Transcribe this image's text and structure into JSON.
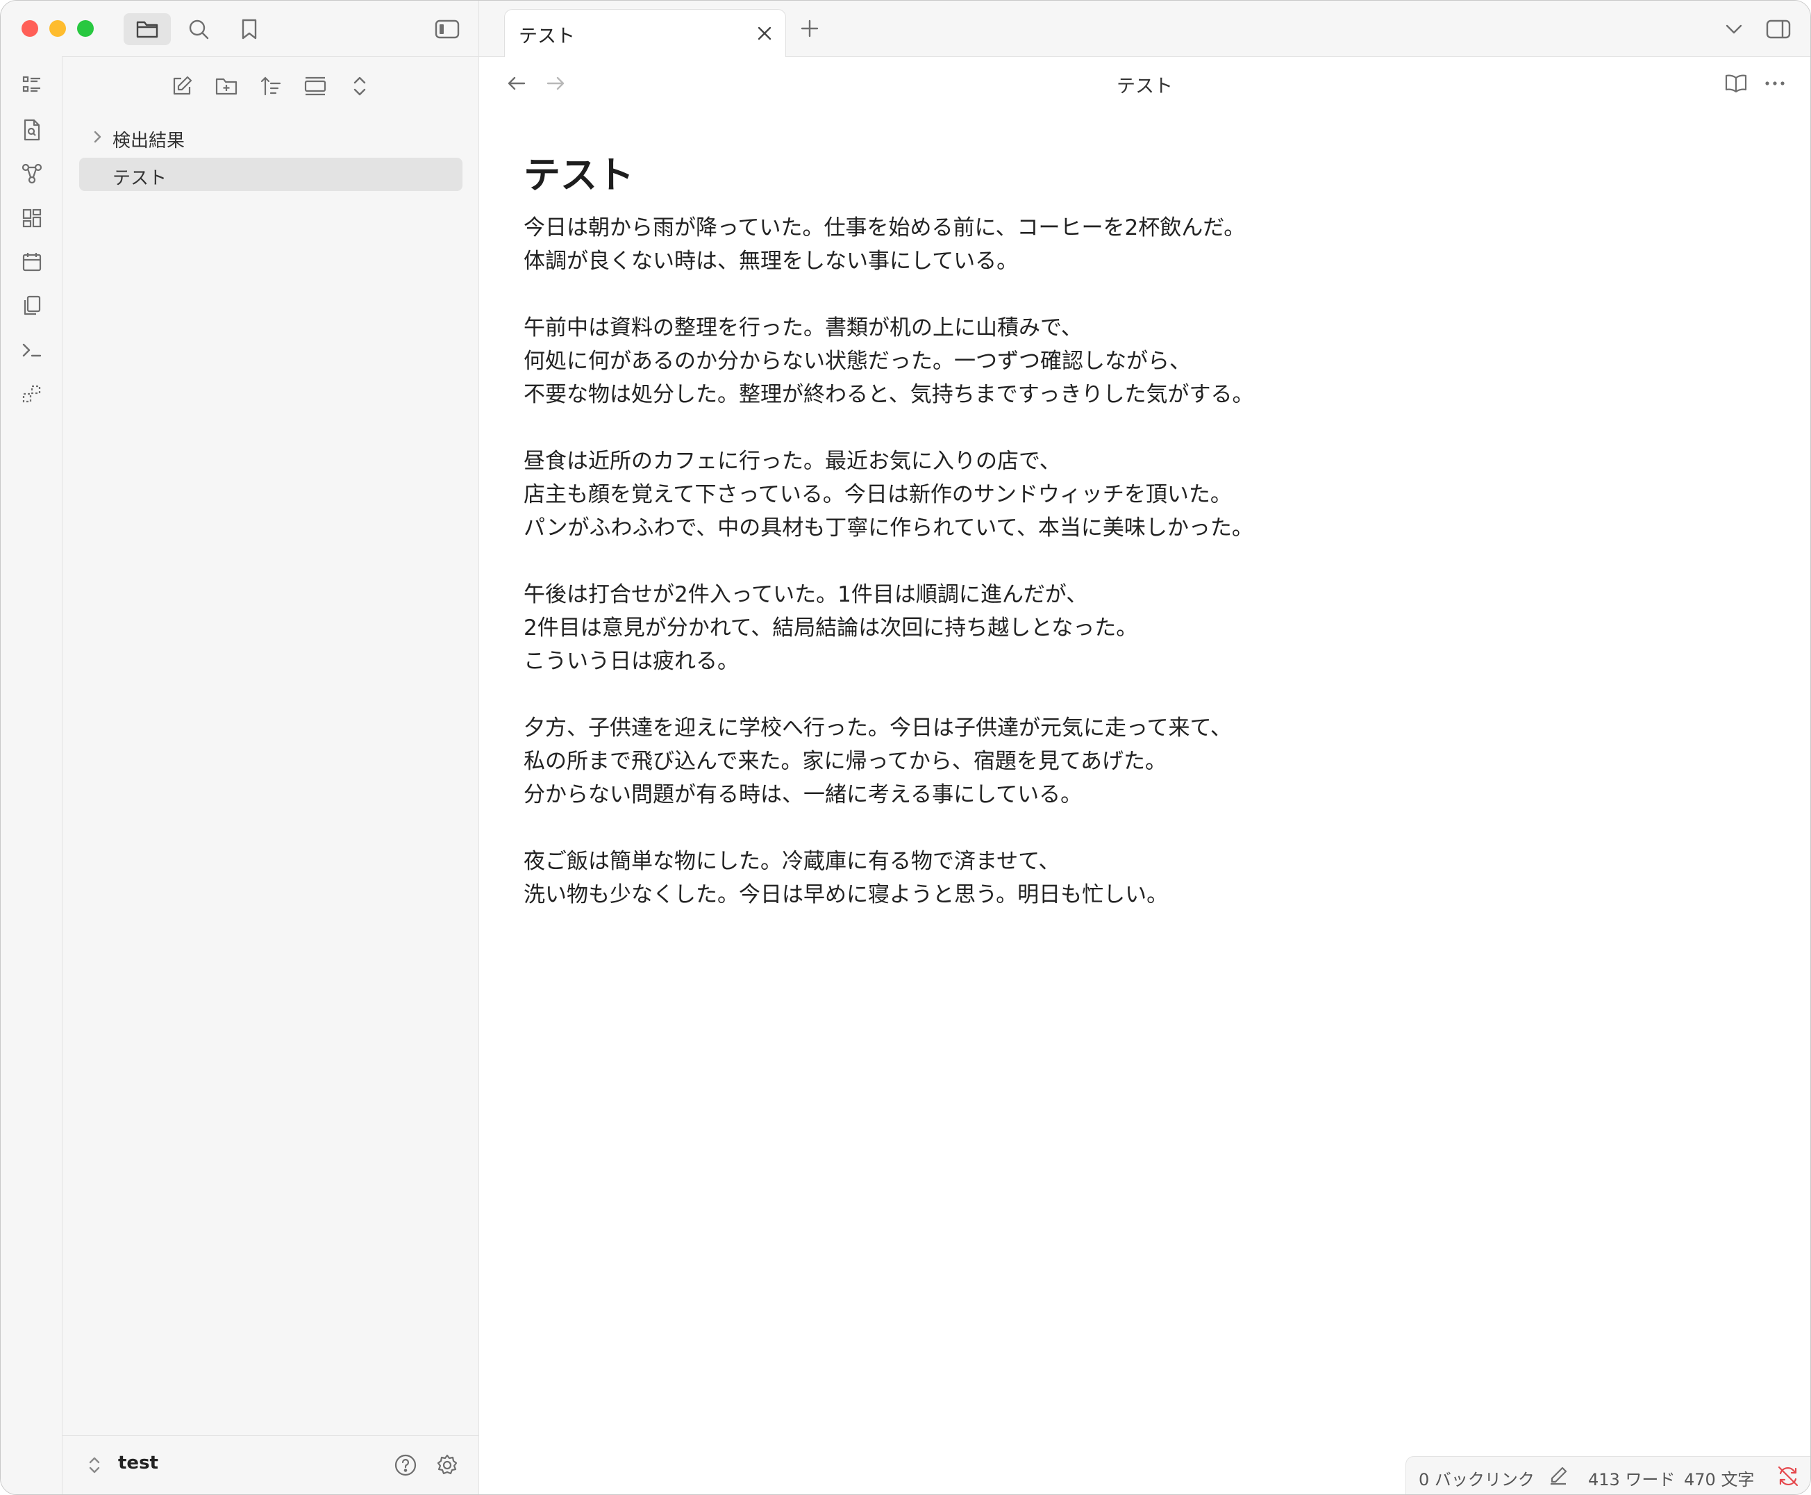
{
  "window": {
    "traffic_lights": {
      "close": "#ff5f57",
      "minimize": "#febc2e",
      "zoom": "#28c840"
    }
  },
  "titlebar": {
    "icons": [
      "folder-icon",
      "search-icon",
      "bookmark-icon",
      "sidebar-toggle-icon"
    ]
  },
  "tabs": [
    {
      "title": "テスト"
    }
  ],
  "ribbon": {
    "icons": [
      "outline-icon",
      "file-search-icon",
      "graph-icon",
      "canvas-icon",
      "calendar-icon",
      "copy-icon",
      "terminal-icon",
      "template-icon"
    ]
  },
  "sidebar": {
    "tree": [
      {
        "label": "検出結果",
        "type": "folder",
        "collapsed": true
      },
      {
        "label": "テスト",
        "type": "file",
        "active": true
      }
    ],
    "vault": {
      "name": "test"
    }
  },
  "editor": {
    "view_title": "テスト",
    "doc_title": "テスト",
    "paragraphs": [
      [
        "今日は朝から雨が降っていた。仕事を始める前に、コーヒーを2杯飲んだ。",
        "体調が良くない時は、無理をしない事にしている。"
      ],
      [
        "午前中は資料の整理を行った。書類が机の上に山積みで、",
        "何処に何があるのか分からない状態だった。一つずつ確認しながら、",
        "不要な物は処分した。整理が終わると、気持ちまですっきりした気がする。"
      ],
      [
        "昼食は近所のカフェに行った。最近お気に入りの店で、",
        "店主も顔を覚えて下さっている。今日は新作のサンドウィッチを頂いた。",
        "パンがふわふわで、中の具材も丁寧に作られていて、本当に美味しかった。"
      ],
      [
        "午後は打合せが2件入っていた。1件目は順調に進んだが、",
        "2件目は意見が分かれて、結局結論は次回に持ち越しとなった。",
        "こういう日は疲れる。"
      ],
      [
        "夕方、子供達を迎えに学校へ行った。今日は子供達が元気に走って来て、",
        "私の所まで飛び込んで来た。家に帰ってから、宿題を見てあげた。",
        "分からない問題が有る時は、一緒に考える事にしている。"
      ],
      [
        "夜ご飯は簡単な物にした。冷蔵庫に有る物で済ませて、",
        "洗い物も少なくした。今日は早めに寝ようと思う。明日も忙しい。"
      ]
    ],
    "lint_color": "#8d9db5"
  },
  "statusbar": {
    "backlinks": "0 バックリンク",
    "words": "413 ワード",
    "chars": "470 文字"
  }
}
